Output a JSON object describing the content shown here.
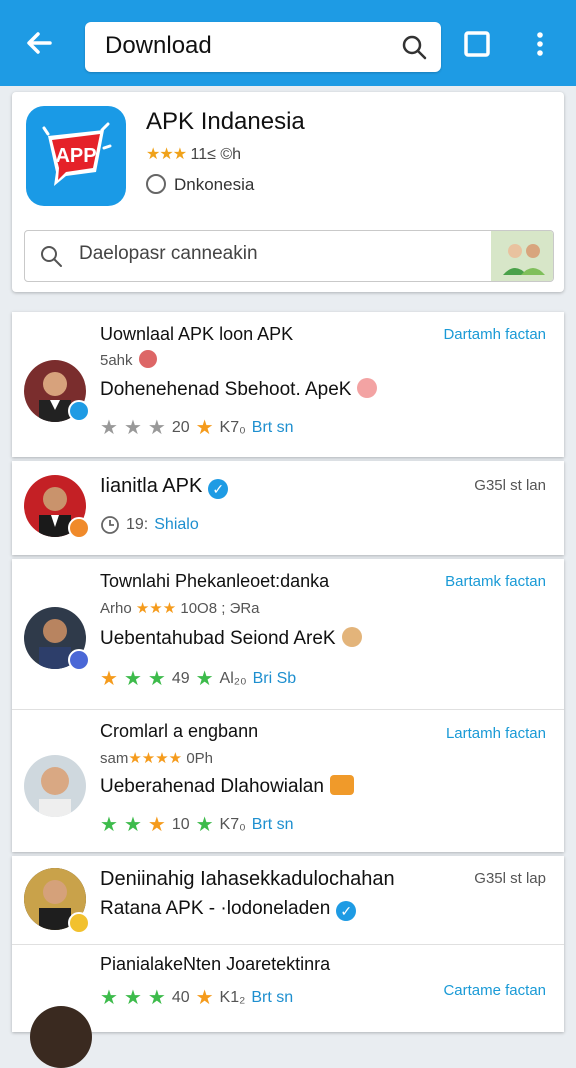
{
  "topbar": {
    "search_value": "Download"
  },
  "app": {
    "icon_label": "APP",
    "title": "APK Indanesia",
    "stars": "★★★",
    "meta": "11≤ ©h",
    "developer": "Dnkonesia",
    "search_placeholder": "Daelopasr canneakin"
  },
  "items": [
    {
      "title": "Uownlaal APK loon APK",
      "sub": "5ahk",
      "desc": "Dohenehenad Sbehoot. ApeK",
      "rating": "20",
      "size": "K7₀",
      "link": "Brt sn",
      "aside": "Dartamh factan"
    },
    {
      "title": "Iianitla APK",
      "time": "19:",
      "link": "Shialo",
      "aside": "G35l st lan"
    },
    {
      "title": "Townlahi Phekanleoet:danka",
      "sub": "Arho",
      "sub_meta": "10O8 ; ЭRa",
      "desc": "Uebentahubad Seiond AreK",
      "rating": "49",
      "size": "Al₂₀",
      "link": "Bri Sb",
      "aside": "Bartamk factan"
    },
    {
      "title": "Cromlarl a engbann",
      "sub": "sam",
      "sub_meta": "0Ph",
      "desc": "Ueberahenad Dlahowialan",
      "rating": "10",
      "size": "K7₀",
      "link": "Brt sn",
      "aside": "Lartamh factan"
    },
    {
      "title": "Deniinahig Iahasekkadulochahan",
      "sub": "Ratana APK - ·lodoneladen",
      "aside": "G35l st lap"
    },
    {
      "title": "Pianialake​Nten Joaretektinra",
      "rating": "40",
      "size": "K1₂",
      "link": "Brt sn",
      "aside": "Cartame factan"
    }
  ],
  "colors": {
    "accent": "#1e9be4",
    "star_orange": "#f59b1c",
    "star_green": "#3dbb4b"
  },
  "icons": [
    "back-arrow-icon",
    "search-icon",
    "square-icon",
    "more-vert-icon",
    "verified-icon",
    "clock-icon",
    "location-icon"
  ]
}
